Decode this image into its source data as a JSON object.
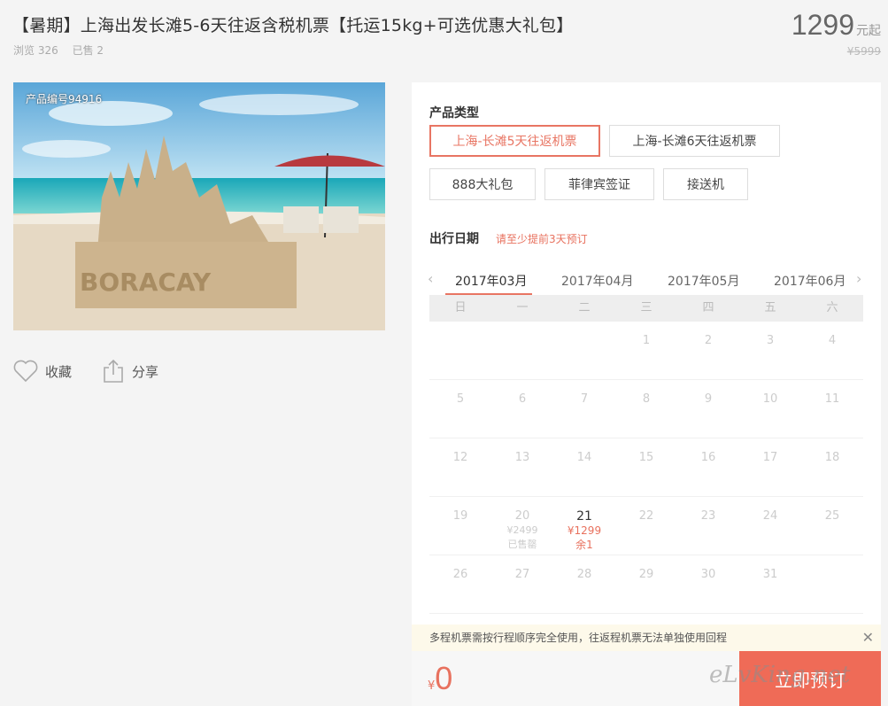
{
  "product": {
    "title": "【暑期】上海出发长滩5-6天往返含税机票【托运15kg+可选优惠大礼包】",
    "views": "浏览 326",
    "sold": "已售 2",
    "price": "1299",
    "price_unit": "元起",
    "old_price": "¥5999",
    "photo_tag": "产品编号94916"
  },
  "actions": {
    "favorite": "收藏",
    "share": "分享"
  },
  "booking": {
    "type_label": "产品类型",
    "types": [
      "上海-长滩5天往返机票",
      "上海-长滩6天往返机票",
      "888大礼包",
      "菲律宾签证",
      "接送机"
    ],
    "active_type": 0,
    "date_label": "出行日期",
    "date_hint": "请至少提前3天预订",
    "months": [
      "2017年03月",
      "2017年04月",
      "2017年05月",
      "2017年06月"
    ],
    "active_month": 0,
    "weekdays": [
      "日",
      "一",
      "二",
      "三",
      "四",
      "五",
      "六"
    ],
    "calendar": [
      [
        {
          "d": ""
        },
        {
          "d": ""
        },
        {
          "d": ""
        },
        {
          "d": "1"
        },
        {
          "d": "2"
        },
        {
          "d": "3"
        },
        {
          "d": "4"
        }
      ],
      [
        {
          "d": "5"
        },
        {
          "d": "6"
        },
        {
          "d": "7"
        },
        {
          "d": "8"
        },
        {
          "d": "9"
        },
        {
          "d": "10"
        },
        {
          "d": "11"
        }
      ],
      [
        {
          "d": "12"
        },
        {
          "d": "13"
        },
        {
          "d": "14"
        },
        {
          "d": "15"
        },
        {
          "d": "16"
        },
        {
          "d": "17"
        },
        {
          "d": "18"
        }
      ],
      [
        {
          "d": "19"
        },
        {
          "d": "20",
          "price": "¥2499",
          "note": "已售罄"
        },
        {
          "d": "21",
          "price": "¥1299",
          "note": "余1",
          "available": true
        },
        {
          "d": "22"
        },
        {
          "d": "23"
        },
        {
          "d": "24"
        },
        {
          "d": "25"
        }
      ],
      [
        {
          "d": "26"
        },
        {
          "d": "27"
        },
        {
          "d": "28"
        },
        {
          "d": "29"
        },
        {
          "d": "30"
        },
        {
          "d": "31"
        },
        {
          "d": ""
        }
      ]
    ],
    "notice": "多程机票需按行程顺序完全使用，往返程机票无法单独使用回程",
    "currency": "¥",
    "total": "0",
    "book_label": "立即预订",
    "watermark": "eLvKing.net"
  },
  "colors": {
    "accent": "#e87563",
    "button": "#ef6b57"
  }
}
